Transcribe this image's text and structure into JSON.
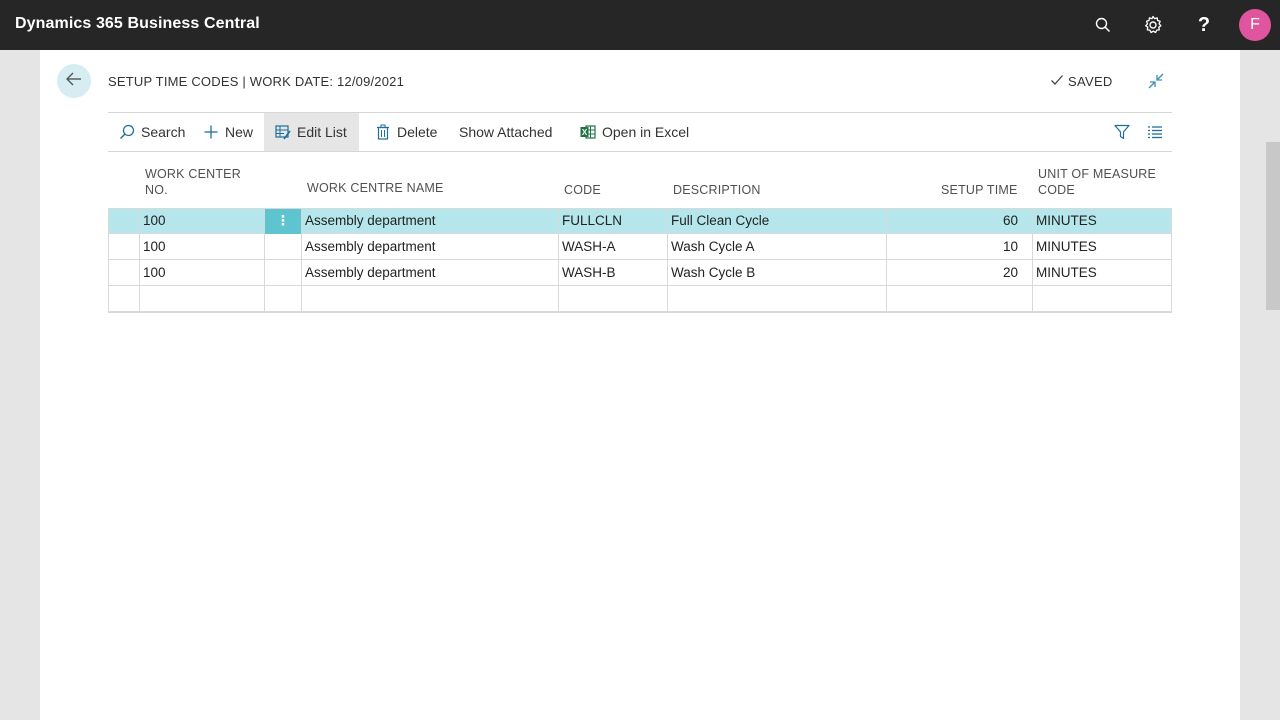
{
  "app": {
    "title": "Dynamics 365 Business Central",
    "user_initial": "F"
  },
  "page": {
    "title": "SETUP TIME CODES | WORK DATE: 12/09/2021",
    "saved_label": "SAVED"
  },
  "actions": {
    "search": "Search",
    "new": "New",
    "edit_list": "Edit List",
    "delete": "Delete",
    "show_attached": "Show Attached",
    "open_in_excel": "Open in Excel"
  },
  "columns": {
    "work_center_no": "WORK CENTER NO.",
    "work_centre_name": "WORK CENTRE NAME",
    "code": "CODE",
    "description": "DESCRIPTION",
    "setup_time": "SETUP TIME",
    "unit_of_measure_code": "UNIT OF MEASURE CODE"
  },
  "rows": [
    {
      "work_center_no": "100",
      "name": "Assembly department",
      "code": "FULLCLN",
      "description": "Full Clean Cycle",
      "setup_time": "60",
      "uom": "MINUTES"
    },
    {
      "work_center_no": "100",
      "name": "Assembly department",
      "code": "WASH-A",
      "description": "Wash Cycle A",
      "setup_time": "10",
      "uom": "MINUTES"
    },
    {
      "work_center_no": "100",
      "name": "Assembly department",
      "code": "WASH-B",
      "description": "Wash Cycle B",
      "setup_time": "20",
      "uom": "MINUTES"
    },
    {
      "work_center_no": "",
      "name": "",
      "code": "",
      "description": "",
      "setup_time": "",
      "uom": ""
    }
  ],
  "icons": {
    "search": "search-icon",
    "settings": "gear-icon",
    "help": "help-icon",
    "back": "arrow-left-icon",
    "saved": "checkmark-icon",
    "collapse": "collapse-icon",
    "new": "plus-icon",
    "edit": "edit-list-icon",
    "delete": "trash-icon",
    "excel": "excel-icon",
    "filter": "filter-icon",
    "list": "list-view-icon",
    "row_menu": "more-vertical-icon"
  },
  "colors": {
    "topbar": "#262626",
    "selected_row": "#b4e6ec",
    "accent": "#5ec4cf",
    "avatar": "#e0569e",
    "excel": "#217346"
  }
}
